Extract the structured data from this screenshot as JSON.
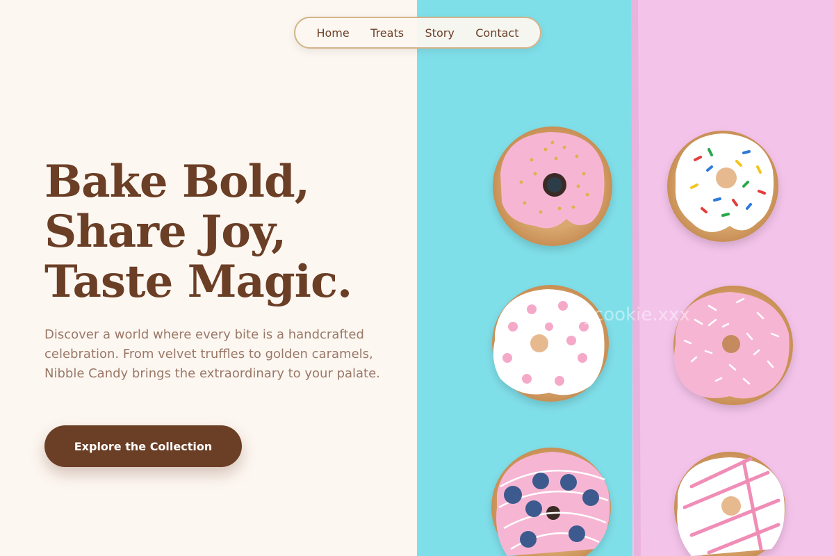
{
  "nav": {
    "items": [
      {
        "label": "Home"
      },
      {
        "label": "Treats"
      },
      {
        "label": "Story"
      },
      {
        "label": "Contact"
      }
    ]
  },
  "hero": {
    "headline_lines": [
      "Bake Bold,",
      "Share Joy,",
      "Taste Magic."
    ],
    "description": "Discover a world where every bite is a handcrafted celebration. From velvet truffles to golden caramels, Nibble Candy brings the extraordinary to your palate.",
    "cta_label": "Explore the Collection"
  },
  "photo": {
    "watermark": "funnycookie.xxx",
    "colors": {
      "left_background": "#7fdfe9",
      "right_background": "#f4c3ea",
      "dough": "#d9a870",
      "pink_icing": "#f6b6d3",
      "white_icing": "#ffffff",
      "blueberry": "#3e5a8e"
    }
  },
  "theme": {
    "brand_brown": "#6b3e26",
    "cream": "#fdf7f1",
    "nav_border": "#d4b48a",
    "body_text": "#9a7868"
  }
}
